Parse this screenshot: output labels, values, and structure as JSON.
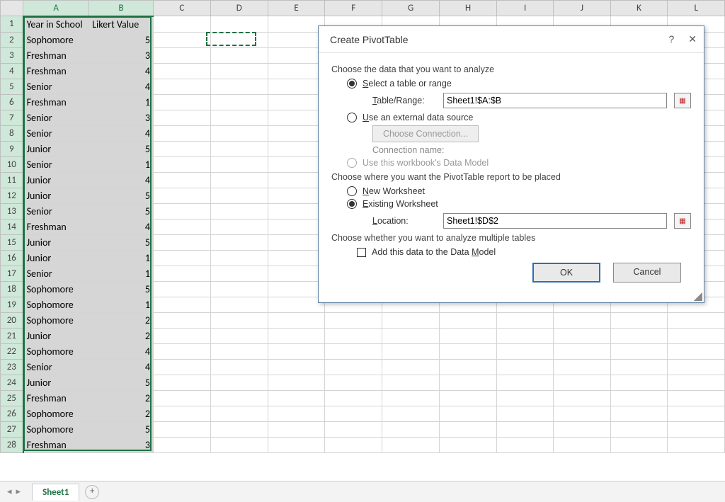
{
  "columns": [
    "A",
    "B",
    "C",
    "D",
    "E",
    "F",
    "G",
    "H",
    "I",
    "J",
    "K",
    "L"
  ],
  "headers": {
    "A": "Year in School",
    "B": "Likert Value"
  },
  "rows": [
    {
      "A": "Sophomore",
      "B": 5
    },
    {
      "A": "Freshman",
      "B": 3
    },
    {
      "A": "Freshman",
      "B": 4
    },
    {
      "A": "Senior",
      "B": 4
    },
    {
      "A": "Freshman",
      "B": 1
    },
    {
      "A": "Senior",
      "B": 3
    },
    {
      "A": "Senior",
      "B": 4
    },
    {
      "A": "Junior",
      "B": 5
    },
    {
      "A": "Senior",
      "B": 1
    },
    {
      "A": "Junior",
      "B": 4
    },
    {
      "A": "Junior",
      "B": 5
    },
    {
      "A": "Senior",
      "B": 5
    },
    {
      "A": "Freshman",
      "B": 4
    },
    {
      "A": "Junior",
      "B": 5
    },
    {
      "A": "Junior",
      "B": 1
    },
    {
      "A": "Senior",
      "B": 1
    },
    {
      "A": "Sophomore",
      "B": 5
    },
    {
      "A": "Sophomore",
      "B": 1
    },
    {
      "A": "Sophomore",
      "B": 2
    },
    {
      "A": "Junior",
      "B": 2
    },
    {
      "A": "Sophomore",
      "B": 4
    },
    {
      "A": "Senior",
      "B": 4
    },
    {
      "A": "Junior",
      "B": 5
    },
    {
      "A": "Freshman",
      "B": 2
    },
    {
      "A": "Sophomore",
      "B": 2
    },
    {
      "A": "Sophomore",
      "B": 5
    },
    {
      "A": "Freshman",
      "B": 3
    }
  ],
  "sheet_tab": "Sheet1",
  "dialog": {
    "title": "Create PivotTable",
    "help_char": "?",
    "close_char": "✕",
    "sec1": "Choose the data that you want to analyze",
    "opt_select_range": "Select a table or range",
    "table_range_label": "Table/Range:",
    "table_range_value": "Sheet1!$A:$B",
    "opt_external": "Use an external data source",
    "choose_conn_btn": "Choose Connection...",
    "conn_name_label": "Connection name:",
    "opt_data_model": "Use this workbook's Data Model",
    "sec2": "Choose where you want the PivotTable report to be placed",
    "opt_new_ws": "New Worksheet",
    "opt_existing_ws": "Existing Worksheet",
    "location_label": "Location:",
    "location_value": "Sheet1!$D$2",
    "sec3": "Choose whether you want to analyze multiple tables",
    "add_dm": "Add this data to the Data Model",
    "ok": "OK",
    "cancel": "Cancel"
  }
}
